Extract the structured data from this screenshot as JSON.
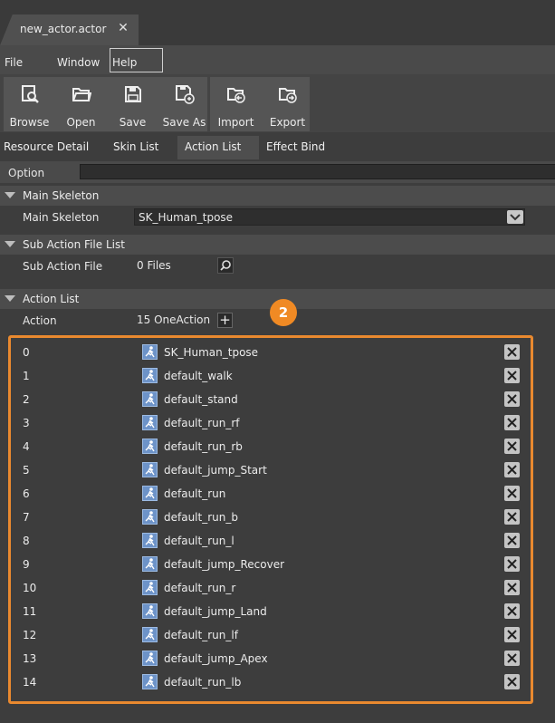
{
  "document_tab": {
    "title": "new_actor.actor",
    "close_icon": "close-icon"
  },
  "menu": {
    "items": [
      "File",
      "Window",
      "Help"
    ]
  },
  "toolbar": {
    "buttons": [
      {
        "label": "Browse",
        "icon": "browse-icon"
      },
      {
        "label": "Open",
        "icon": "folder-open-icon"
      },
      {
        "label": "Save",
        "icon": "save-icon"
      },
      {
        "label": "Save As",
        "icon": "save-as-icon"
      },
      {
        "label": "Import",
        "icon": "import-icon"
      },
      {
        "label": "Export",
        "icon": "export-icon"
      }
    ]
  },
  "subtabs": {
    "items": [
      "Resource Detail",
      "Skin List",
      "Action List",
      "Effect Bind"
    ],
    "active": "Action List"
  },
  "option": {
    "label": "Option",
    "value": ""
  },
  "main_skeleton": {
    "section_title": "Main Skeleton",
    "label": "Main Skeleton",
    "value": "SK_Human_tpose"
  },
  "sub_action": {
    "section_title": "Sub Action File List",
    "label": "Sub Action File",
    "value": "0 Files"
  },
  "action_list": {
    "section_title": "Action List",
    "label": "Action",
    "value": "15 OneAction",
    "add_icon": "plus-icon",
    "marker": "2",
    "items": [
      {
        "index": "0",
        "name": "SK_Human_tpose"
      },
      {
        "index": "1",
        "name": "default_walk"
      },
      {
        "index": "2",
        "name": "default_stand"
      },
      {
        "index": "3",
        "name": "default_run_rf"
      },
      {
        "index": "4",
        "name": "default_run_rb"
      },
      {
        "index": "5",
        "name": "default_jump_Start"
      },
      {
        "index": "6",
        "name": "default_run"
      },
      {
        "index": "7",
        "name": "default_run_b"
      },
      {
        "index": "8",
        "name": "default_run_l"
      },
      {
        "index": "9",
        "name": "default_jump_Recover"
      },
      {
        "index": "10",
        "name": "default_run_r"
      },
      {
        "index": "11",
        "name": "default_jump_Land"
      },
      {
        "index": "12",
        "name": "default_run_lf"
      },
      {
        "index": "13",
        "name": "default_jump_Apex"
      },
      {
        "index": "14",
        "name": "default_run_lb"
      }
    ]
  },
  "colors": {
    "accent": "#f08a24",
    "background": "#3d3d3d",
    "action_icon": "#6d93c8"
  }
}
